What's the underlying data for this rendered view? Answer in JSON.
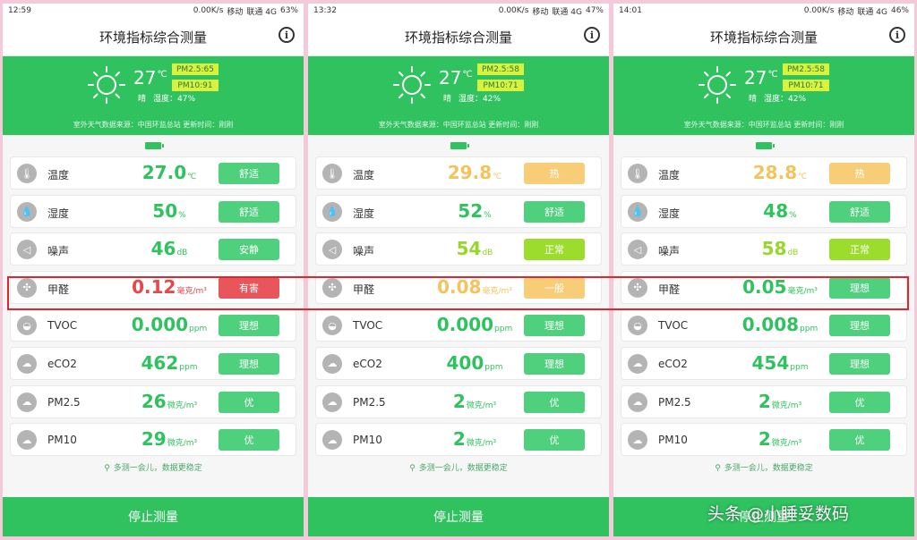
{
  "colors": {
    "green": "#2fc25f",
    "orange": "#f3c45d",
    "red": "#e8464b",
    "lime": "#97d62a",
    "status_green": "#4ed07d",
    "status_orange": "#f7cd77",
    "status_red": "#e8555a",
    "status_lime": "#9bdc2c"
  },
  "screens": [
    {
      "statusbar": {
        "time": "12:59",
        "net": "0.00K/s",
        "carrier1": "移动",
        "carrier2": "联通 4G",
        "battery": "63%"
      },
      "app_title": "环境指标综合测量",
      "weather": {
        "temp": "27",
        "unit": "℃",
        "condition": "晴",
        "humidity": "湿度：47%",
        "pm25": "PM2.5:65",
        "pm10": "PM10:91",
        "source": "室外天气数据来源：中国环监总站   更新时间：刚刚"
      },
      "rows": [
        {
          "icon": "thermometer-icon",
          "label": "温度",
          "value": "27.0",
          "unit": "℃",
          "color": "green",
          "status": "舒适",
          "status_color": "status_green"
        },
        {
          "icon": "humidity-icon",
          "label": "湿度",
          "value": "50",
          "unit": "%",
          "color": "green",
          "status": "舒适",
          "status_color": "status_green"
        },
        {
          "icon": "noise-icon",
          "label": "噪声",
          "value": "46",
          "unit": "dB",
          "color": "green",
          "status": "安静",
          "status_color": "status_green"
        },
        {
          "icon": "fan-icon",
          "label": "甲醛",
          "value": "0.12",
          "unit": "毫克/m³",
          "color": "red",
          "status": "有害",
          "status_color": "status_red"
        },
        {
          "icon": "tvoc-icon",
          "label": "TVOC",
          "value": "0.000",
          "unit": "ppm",
          "color": "green",
          "status": "理想",
          "status_color": "status_green"
        },
        {
          "icon": "cloud-icon",
          "label": "eCO2",
          "value": "462",
          "unit": "ppm",
          "color": "green",
          "status": "理想",
          "status_color": "status_green"
        },
        {
          "icon": "cloud-icon",
          "label": "PM2.5",
          "value": "26",
          "unit": "微克/m³",
          "color": "green",
          "status": "优",
          "status_color": "status_green"
        },
        {
          "icon": "cloud-icon",
          "label": "PM10",
          "value": "29",
          "unit": "微克/m³",
          "color": "green",
          "status": "优",
          "status_color": "status_green"
        }
      ],
      "tip": "多测一会儿，数据更稳定",
      "stop_label": "停止测量"
    },
    {
      "statusbar": {
        "time": "13:32",
        "net": "0.00K/s",
        "carrier1": "移动",
        "carrier2": "联通 4G",
        "battery": "47%"
      },
      "app_title": "环境指标综合测量",
      "weather": {
        "temp": "27",
        "unit": "℃",
        "condition": "晴",
        "humidity": "湿度：42%",
        "pm25": "PM2.5:58",
        "pm10": "PM10:71",
        "source": "室外天气数据来源：中国环监总站   更新时间：刚刚"
      },
      "rows": [
        {
          "icon": "thermometer-icon",
          "label": "温度",
          "value": "29.8",
          "unit": "℃",
          "color": "orange",
          "status": "热",
          "status_color": "status_orange"
        },
        {
          "icon": "humidity-icon",
          "label": "湿度",
          "value": "52",
          "unit": "%",
          "color": "green",
          "status": "舒适",
          "status_color": "status_green"
        },
        {
          "icon": "noise-icon",
          "label": "噪声",
          "value": "54",
          "unit": "dB",
          "color": "lime",
          "status": "正常",
          "status_color": "status_lime"
        },
        {
          "icon": "fan-icon",
          "label": "甲醛",
          "value": "0.08",
          "unit": "毫克/m³",
          "color": "orange",
          "status": "一般",
          "status_color": "status_orange"
        },
        {
          "icon": "tvoc-icon",
          "label": "TVOC",
          "value": "0.000",
          "unit": "ppm",
          "color": "green",
          "status": "理想",
          "status_color": "status_green"
        },
        {
          "icon": "cloud-icon",
          "label": "eCO2",
          "value": "400",
          "unit": "ppm",
          "color": "green",
          "status": "理想",
          "status_color": "status_green"
        },
        {
          "icon": "cloud-icon",
          "label": "PM2.5",
          "value": "2",
          "unit": "微克/m³",
          "color": "green",
          "status": "优",
          "status_color": "status_green"
        },
        {
          "icon": "cloud-icon",
          "label": "PM10",
          "value": "2",
          "unit": "微克/m³",
          "color": "green",
          "status": "优",
          "status_color": "status_green"
        }
      ],
      "tip": "多测一会儿，数据更稳定",
      "stop_label": "停止测量"
    },
    {
      "statusbar": {
        "time": "14:01",
        "net": "0.00K/s",
        "carrier1": "移动",
        "carrier2": "联通 4G",
        "battery": "46%"
      },
      "app_title": "环境指标综合测量",
      "weather": {
        "temp": "27",
        "unit": "℃",
        "condition": "晴",
        "humidity": "湿度：42%",
        "pm25": "PM2.5:58",
        "pm10": "PM10:71",
        "source": "室外天气数据来源：中国环监总站   更新时间：刚刚"
      },
      "rows": [
        {
          "icon": "thermometer-icon",
          "label": "温度",
          "value": "28.8",
          "unit": "℃",
          "color": "orange",
          "status": "热",
          "status_color": "status_orange"
        },
        {
          "icon": "humidity-icon",
          "label": "湿度",
          "value": "48",
          "unit": "%",
          "color": "green",
          "status": "舒适",
          "status_color": "status_green"
        },
        {
          "icon": "noise-icon",
          "label": "噪声",
          "value": "58",
          "unit": "dB",
          "color": "lime",
          "status": "正常",
          "status_color": "status_lime"
        },
        {
          "icon": "fan-icon",
          "label": "甲醛",
          "value": "0.05",
          "unit": "毫克/m³",
          "color": "green",
          "status": "理想",
          "status_color": "status_green"
        },
        {
          "icon": "tvoc-icon",
          "label": "TVOC",
          "value": "0.008",
          "unit": "ppm",
          "color": "green",
          "status": "理想",
          "status_color": "status_green"
        },
        {
          "icon": "cloud-icon",
          "label": "eCO2",
          "value": "454",
          "unit": "ppm",
          "color": "green",
          "status": "理想",
          "status_color": "status_green"
        },
        {
          "icon": "cloud-icon",
          "label": "PM2.5",
          "value": "2",
          "unit": "微克/m³",
          "color": "green",
          "status": "优",
          "status_color": "status_green"
        },
        {
          "icon": "cloud-icon",
          "label": "PM10",
          "value": "2",
          "unit": "微克/m³",
          "color": "green",
          "status": "优",
          "status_color": "status_green"
        }
      ],
      "tip": "多测一会儿，数据更稳定",
      "stop_label": "停止测量"
    }
  ],
  "watermark": "头条 @小睡妥数码"
}
